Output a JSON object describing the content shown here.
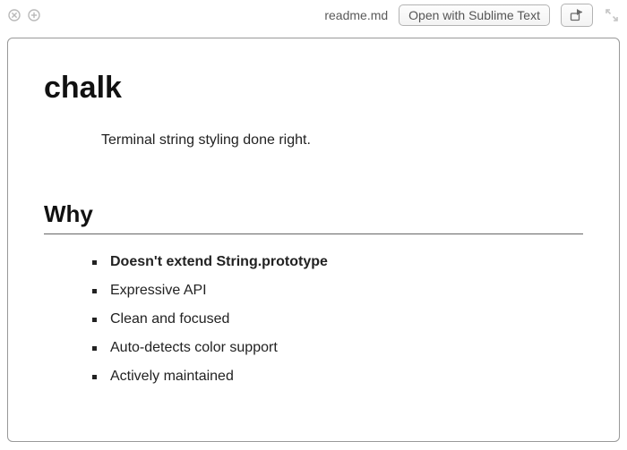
{
  "header": {
    "filename": "readme.md",
    "open_button": "Open with Sublime Text"
  },
  "document": {
    "title": "chalk",
    "tagline": "Terminal string styling done right.",
    "section_heading": "Why",
    "why_items": [
      {
        "text": "Doesn't extend String.prototype",
        "bold": true
      },
      {
        "text": "Expressive API",
        "bold": false
      },
      {
        "text": "Clean and focused",
        "bold": false
      },
      {
        "text": "Auto-detects color support",
        "bold": false
      },
      {
        "text": "Actively maintained",
        "bold": false
      }
    ]
  }
}
